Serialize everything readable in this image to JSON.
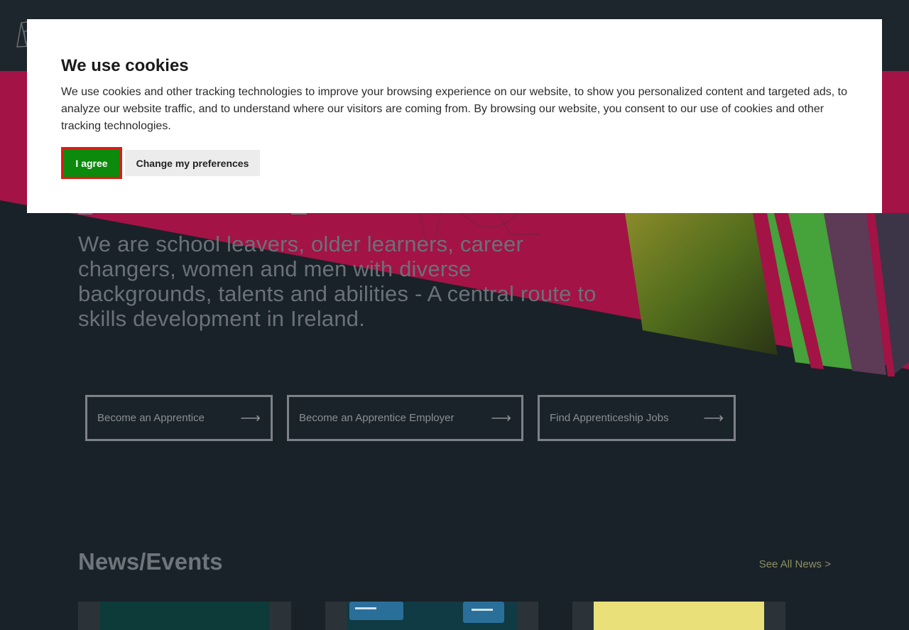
{
  "cookie_dialog": {
    "title": "We use cookies",
    "body": "We use cookies and other tracking technologies to improve your browsing experience on our website, to show you personalized content and targeted ads, to analyze our website traffic, and to understand where our visitors are coming from. By browsing our website, you consent to our use of cookies and other tracking technologies.",
    "agree_label": "I agree",
    "preferences_label": "Change my preferences"
  },
  "hero": {
    "description": "We are school leavers, older learners, career changers, women and men with diverse backgrounds, talents and abilities - A central route to skills development in Ireland."
  },
  "cta_buttons": [
    {
      "label": "Become an Apprentice",
      "arrow": "⟶"
    },
    {
      "label": "Become an Apprentice Employer",
      "arrow": "⟶"
    },
    {
      "label": "Find Apprenticeship Jobs",
      "arrow": "⟶"
    }
  ],
  "news": {
    "title": "News/Events",
    "see_all": "See All News >"
  },
  "colors": {
    "background": "#192228",
    "hero_magenta": "#b3134a",
    "agree_green": "#0b8a0b",
    "agree_outline": "#e31818",
    "link": "#8c8f64"
  },
  "icons": [
    "logo-icon",
    "arrow-right-icon"
  ]
}
